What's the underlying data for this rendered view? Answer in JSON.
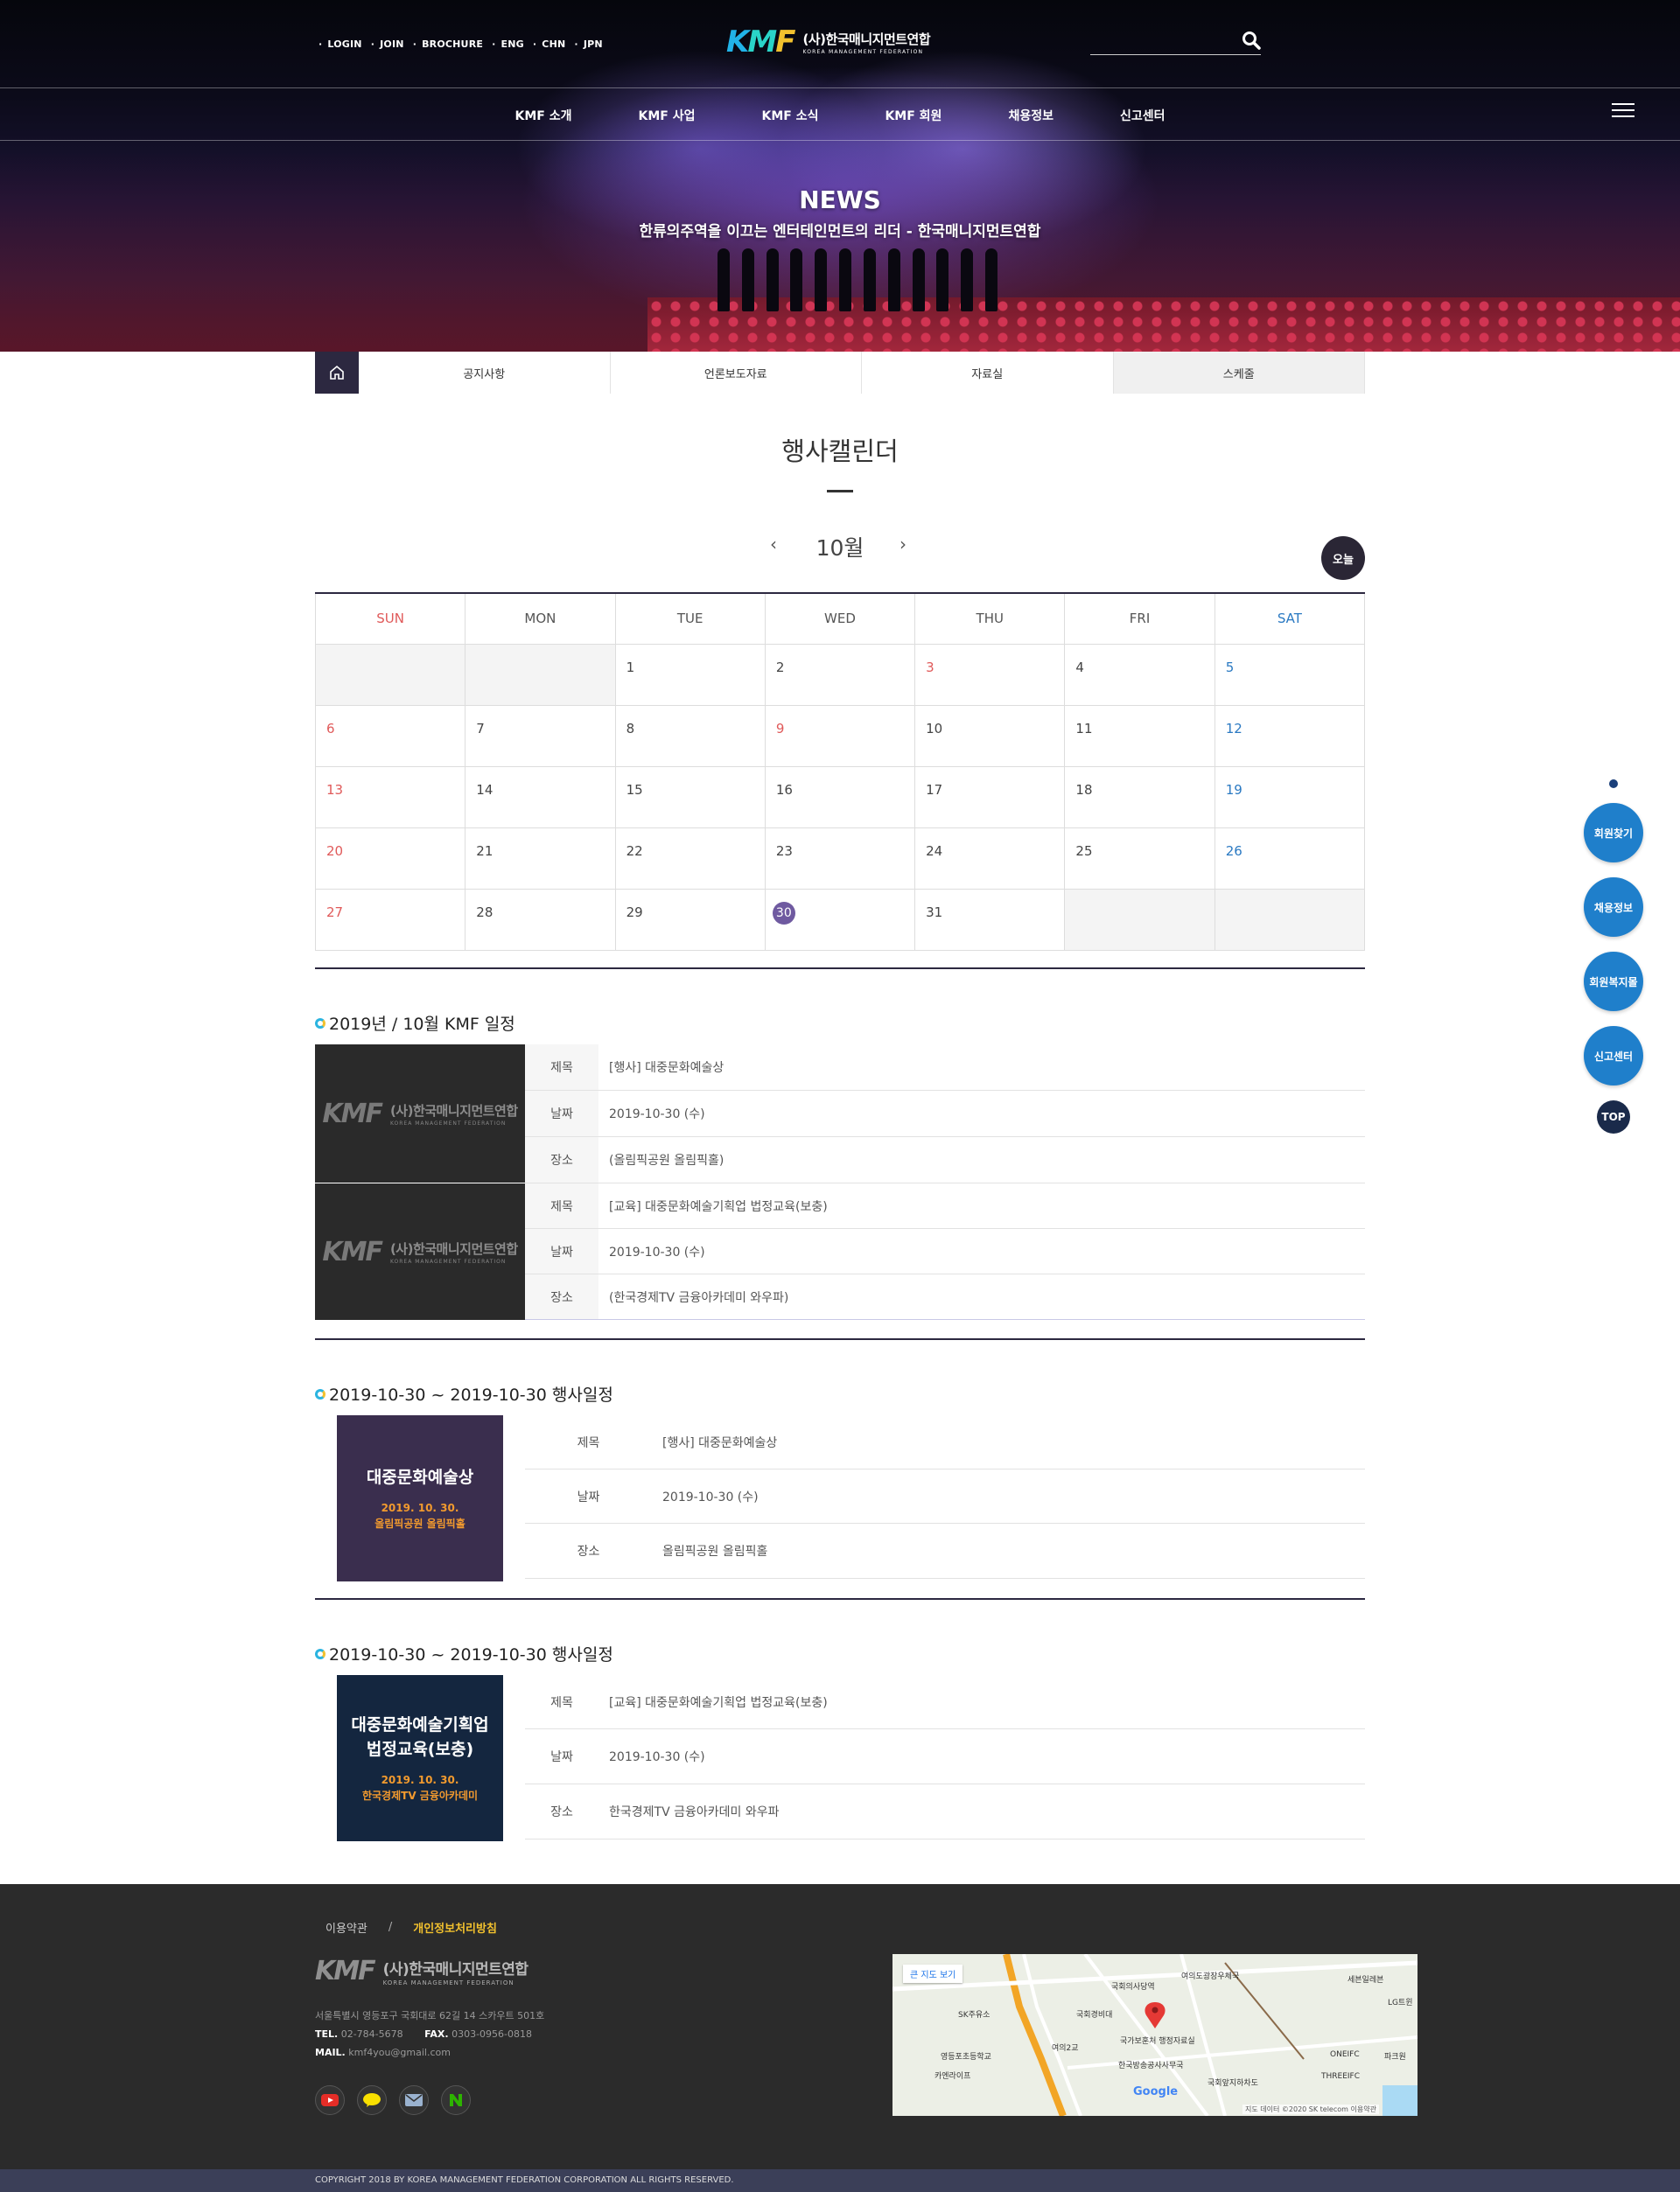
{
  "header": {
    "util_links": [
      "LOGIN",
      "JOIN",
      "BROCHURE",
      "ENG",
      "CHN",
      "JPN"
    ],
    "logo_mark": "KMF",
    "logo_name": "(사)한국매니지먼트연합",
    "logo_sub": "KOREA MANAGEMENT FEDERATION",
    "gnb": [
      "KMF 소개",
      "KMF 사업",
      "KMF 소식",
      "KMF 회원",
      "채용정보",
      "신고센터"
    ]
  },
  "hero": {
    "title": "NEWS",
    "subtitle": "한류의주역을 이끄는 엔터테인먼트의 리더 - 한국매니지먼트연합"
  },
  "subnav": [
    "공지사항",
    "언론보도자료",
    "자료실",
    "스케줄"
  ],
  "page_title": "행사캘린더",
  "calendar": {
    "prev": "‹",
    "month": "10월",
    "next": "›",
    "today_btn": "오늘",
    "weekdays": [
      "SUN",
      "MON",
      "TUE",
      "WED",
      "THU",
      "FRI",
      "SAT"
    ],
    "weeks": [
      [
        "",
        "",
        "1",
        "2",
        "3",
        "4",
        "5"
      ],
      [
        "6",
        "7",
        "8",
        "9",
        "10",
        "11",
        "12"
      ],
      [
        "13",
        "14",
        "15",
        "16",
        "17",
        "18",
        "19"
      ],
      [
        "20",
        "21",
        "22",
        "23",
        "24",
        "25",
        "26"
      ],
      [
        "27",
        "28",
        "29",
        "30",
        "31",
        "",
        ""
      ]
    ]
  },
  "month_schedule": {
    "title": "2019년 / 10월 KMF 일정",
    "labels": {
      "title": "제목",
      "date": "날짜",
      "place": "장소"
    },
    "items": [
      {
        "title": "[행사] 대중문화예술상",
        "date": "2019-10-30 (수)",
        "place": "(올림픽공원 올림픽홀)"
      },
      {
        "title": "[교육] 대중문화예술기획업 법정교육(보충)",
        "date": "2019-10-30 (수)",
        "place": "(한국경제TV 금융아카데미 와우파)"
      }
    ]
  },
  "event1": {
    "title": "2019-10-30 ~ 2019-10-30 행사일정",
    "poster_title": "대중문화예술상",
    "poster_date": "2019. 10. 30.",
    "poster_place": "올림픽공원 올림픽홀",
    "title_val": "[행사] 대중문화예술상",
    "date_val": "2019-10-30 (수)",
    "place_val": "올림픽공원 올림픽홀"
  },
  "event2": {
    "title": "2019-10-30 ~ 2019-10-30 행사일정",
    "poster_title1": "대중문화예술기획업",
    "poster_title2": "법정교육(보충)",
    "poster_date": "2019. 10. 30.",
    "poster_place": "한국경제TV 금융아카데미",
    "title_val": "[교육] 대중문화예술기획업 법정교육(보충)",
    "date_val": "2019-10-30 (수)",
    "place_val": "한국경제TV 금융아카데미 와우파"
  },
  "quick_menu": [
    "회원찾기",
    "채용정보",
    "회원복지몰",
    "신고센터"
  ],
  "top_btn": "TOP",
  "footer": {
    "links": [
      "이용약관",
      "/",
      "개인정보처리방침"
    ],
    "address": "서울특별시 영등포구 국회대로 62길 14 스카우트 501호",
    "tel_label": "TEL.",
    "tel": "02-784-5678",
    "fax_label": "FAX.",
    "fax": "0303-0956-0818",
    "mail_label": "MAIL.",
    "mail": "kmf4you@gmail.com",
    "map_btn": "큰 지도 보기",
    "map_labels": [
      "국회의사당역",
      "여의도광장우체국",
      "국회경비대",
      "국가보훈처 행정자료실",
      "한국방송공사사무국",
      "영등포초등학교",
      "SK주유소",
      "카엔라이프",
      "여의2교",
      "ONEIFC",
      "THREEIFC",
      "파크원",
      "LG트윈",
      "세븐일레븐",
      "국회앞지하차도",
      "Google"
    ],
    "map_credit": "지도 데이터 ©2020 SK telecom  이용약관",
    "copyright": "COPYRIGHT 2018 BY KOREA MANAGEMENT FEDERATION CORPORATION ALL RIGHTS RESERVED."
  },
  "colors": {
    "accent": "#2c2840",
    "quick": "#1f7fcb",
    "sun": "#e05a5a",
    "sat": "#2a79c2",
    "today": "#6f5aa0",
    "highlight": "#f2c12e"
  }
}
